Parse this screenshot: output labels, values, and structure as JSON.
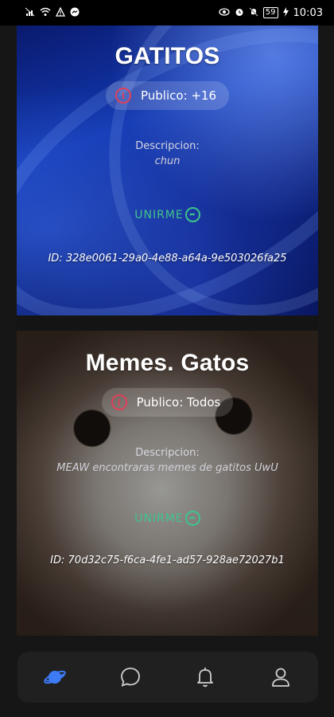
{
  "status_bar": {
    "time": "10:03",
    "battery": "59"
  },
  "groups": [
    {
      "title": "GATITOS",
      "privacy": "Publico: +16",
      "description_label": "Descripcion:",
      "description": "chun",
      "join_label": "UNIRME",
      "id_text": "ID: 328e0061-29a0-4e88-a64a-9e503026fa25"
    },
    {
      "title": "Memes. Gatos",
      "privacy": "Publico: Todos",
      "description_label": "Descripcion:",
      "description": "MEAW encontraras memes de gatitos UwU",
      "join_label": "UNIRME",
      "id_text": "ID: 70d32c75-f6ca-4fe1-ad57-928ae72027b1"
    }
  ],
  "nav": {
    "items": [
      {
        "icon": "planet-icon",
        "active": true
      },
      {
        "icon": "chat-bubble-icon",
        "active": false
      },
      {
        "icon": "bell-icon",
        "active": false
      },
      {
        "icon": "profile-icon",
        "active": false
      }
    ]
  },
  "colors": {
    "accent": "#3d7bf5",
    "join": "#3ec48a",
    "info": "#e0405a",
    "nav_inactive": "#cfcfcf"
  }
}
